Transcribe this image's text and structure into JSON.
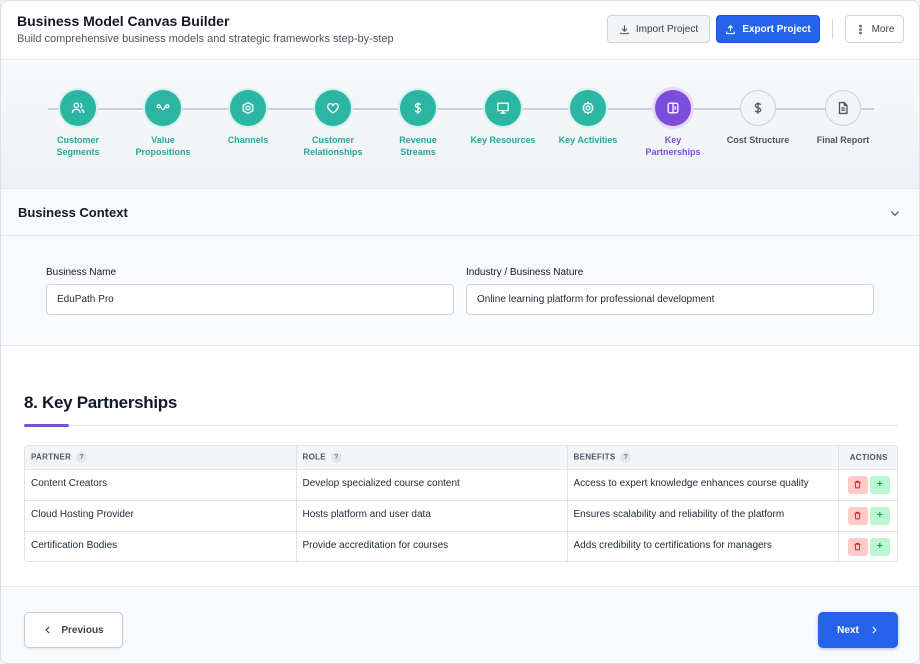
{
  "header": {
    "title": "Business Model Canvas Builder",
    "subtitle": "Build comprehensive business models and strategic frameworks step-by-step",
    "import_label": "Import Project",
    "export_label": "Export Project",
    "more_label": "More"
  },
  "steps": [
    {
      "line1": "Customer",
      "line2": "Segments",
      "state": "done",
      "icon": "users-icon"
    },
    {
      "line1": "Value",
      "line2": "Propositions",
      "state": "done",
      "icon": "value-icon"
    },
    {
      "line1": "Channels",
      "line2": "",
      "state": "done",
      "icon": "channels-icon"
    },
    {
      "line1": "Customer",
      "line2": "Relationships",
      "state": "done",
      "icon": "heart-icon"
    },
    {
      "line1": "Revenue",
      "line2": "Streams",
      "state": "done",
      "icon": "dollar-icon"
    },
    {
      "line1": "Key Resources",
      "line2": "",
      "state": "done",
      "icon": "monitor-icon"
    },
    {
      "line1": "Key Activities",
      "line2": "",
      "state": "done",
      "icon": "gear-icon"
    },
    {
      "line1": "Key",
      "line2": "Partnerships",
      "state": "active",
      "icon": "partnership-icon"
    },
    {
      "line1": "Cost Structure",
      "line2": "",
      "state": "todo",
      "icon": "dollar-icon"
    },
    {
      "line1": "Final Report",
      "line2": "",
      "state": "todo",
      "icon": "document-icon"
    }
  ],
  "context": {
    "title": "Business Context",
    "business_name_label": "Business Name",
    "business_name_value": "EduPath Pro",
    "industry_label": "Industry / Business Nature",
    "industry_value": "Online learning platform for professional development"
  },
  "section": {
    "title": "8. Key Partnerships"
  },
  "table": {
    "columns": [
      "PARTNER",
      "ROLE",
      "BENEFITS",
      "ACTIONS"
    ],
    "rows": [
      {
        "partner": "Content Creators",
        "role": "Develop specialized course content",
        "benefits": "Access to expert knowledge enhances course quality"
      },
      {
        "partner": "Cloud Hosting Provider",
        "role": "Hosts platform and user data",
        "benefits": "Ensures scalability and reliability of the platform"
      },
      {
        "partner": "Certification Bodies",
        "role": "Provide accreditation for courses",
        "benefits": "Adds credibility to certifications for managers"
      }
    ],
    "help_glyph": "?",
    "add_glyph": "+"
  },
  "footer": {
    "previous_label": "Previous",
    "next_label": "Next"
  },
  "colors": {
    "done": "#2bb5a3",
    "active": "#7c4ddb",
    "primary": "#2563eb"
  }
}
